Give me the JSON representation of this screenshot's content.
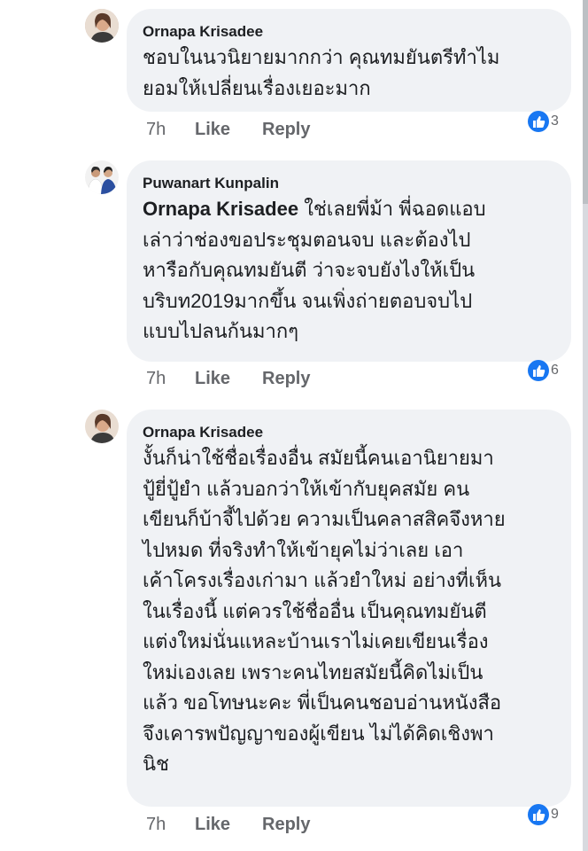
{
  "comments": [
    {
      "author": "Ornapa Krisadee",
      "mention": "",
      "lines": [
        "ชอบในนวนิยายมากกว่า คุณทมยันตรีทำไม",
        "ยอมให้เปลี่ยนเรื่องเยอะมาก"
      ],
      "time": "7h",
      "like_label": "Like",
      "reply_label": "Reply",
      "reaction_count": "3",
      "avatar_icon": "profile-photo-woman"
    },
    {
      "author": "Puwanart Kunpalin",
      "mention": "Ornapa Krisadee",
      "lines": [
        " ใช่เลยพี่ม้า พี่ฉอดแอบ",
        "เล่าว่าช่องขอประชุมตอนจบ และต้องไป",
        "หารือกับคุณทมยันตี ว่าจะจบยังไงให้เป็น",
        "บริบท2019มากขึ้น จนเพิ่งถ่ายตอบจบไป",
        "แบบไปลนก้นมากๆ"
      ],
      "time": "7h",
      "like_label": "Like",
      "reply_label": "Reply",
      "reaction_count": "6",
      "avatar_icon": "profile-photo-group"
    },
    {
      "author": "Ornapa Krisadee",
      "mention": "",
      "lines": [
        "งั้นก็น่าใช้ชื่อเรื่องอื่น สมัยนี้คนเอานิยายมา",
        "ปู้ยี่ปู้ยำ แล้วบอกว่าให้เข้ากับยุคสมัย คน",
        "เขียนก็บ้าจี้ไปด้วย ความเป็นคลาสสิคจึงหาย",
        "ไปหมด ที่จริงทำให้เข้ายุคไม่ว่าเลย เอา",
        "เค้าโครงเรื่องเก่ามา แล้วยำใหม่ อย่างที่เห็น",
        "ในเรื่องนี้ แต่ควรใช้ชื่ออื่น เป็นคุณทมยันตี",
        "แต่งใหม่นั่นแหละบ้านเราไม่เคยเขียนเรื่อง",
        "ใหม่เองเลย เพราะคนไทยสมัยนี้คิดไม่เป็น",
        "แล้ว ขอโทษนะคะ พี่เป็นคนชอบอ่านหนังสือ",
        "จึงเคารพปัญญาของผู้เขียน ไม่ได้คิดเชิงพา",
        "นิช"
      ],
      "time": "7h",
      "like_label": "Like",
      "reply_label": "Reply",
      "reaction_count": "9",
      "avatar_icon": "profile-photo-woman"
    }
  ],
  "colors": {
    "bubble": "#f0f2f5",
    "like_blue": "#1877f2",
    "meta_gray": "#65676b"
  }
}
